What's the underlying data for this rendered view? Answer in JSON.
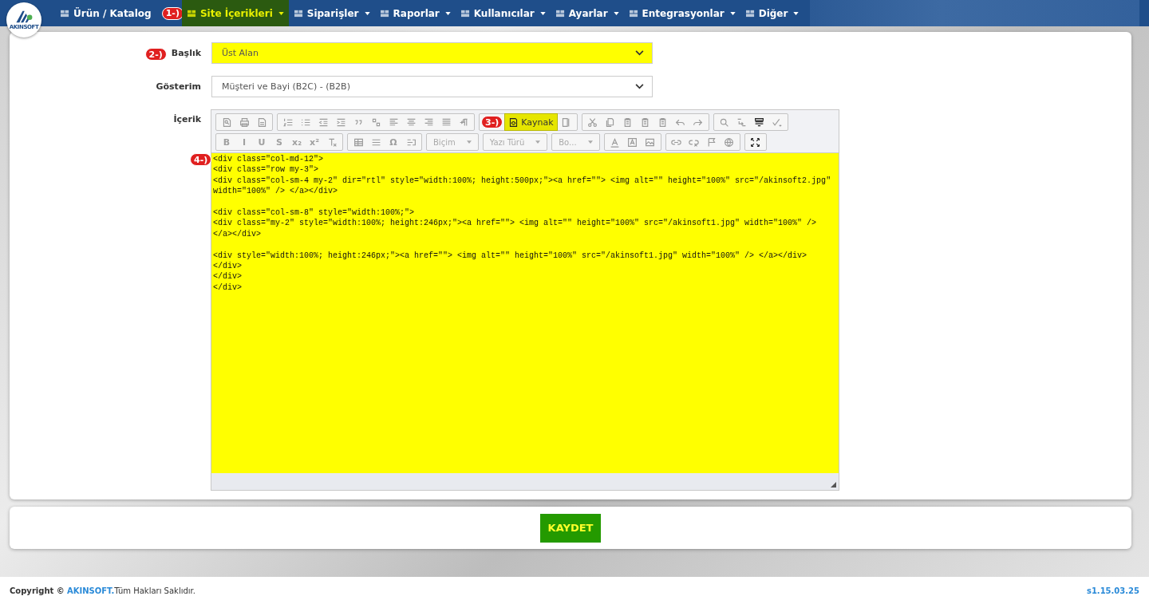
{
  "logo": {
    "text": "AKINSOFT"
  },
  "nav": [
    {
      "label": "Ürün / Katalog",
      "selected": false,
      "caret": false
    },
    {
      "label": "Site İçerikleri",
      "selected": true,
      "caret": true,
      "annotation": "1-)"
    },
    {
      "label": "Siparişler",
      "selected": false,
      "caret": true
    },
    {
      "label": "Raporlar",
      "selected": false,
      "caret": true
    },
    {
      "label": "Kullanıcılar",
      "selected": false,
      "caret": true
    },
    {
      "label": "Ayarlar",
      "selected": false,
      "caret": true
    },
    {
      "label": "Entegrasyonlar",
      "selected": false,
      "caret": true
    },
    {
      "label": "Diğer",
      "selected": false,
      "caret": true
    }
  ],
  "form": {
    "fields": [
      {
        "label": "Başlık",
        "value": "Üst Alan",
        "highlighted": true,
        "annotation": "2-)"
      },
      {
        "label": "Gösterim",
        "value": "Müşteri ve Bayi (B2C) - (B2B)",
        "highlighted": false
      }
    ],
    "editor": {
      "label": "İçerik",
      "annotation": "4-)",
      "toolbar_rows": [
        [
          [
            {
              "kind": "icon",
              "disabled": true
            },
            {
              "kind": "icon",
              "disabled": true
            },
            {
              "kind": "icon",
              "disabled": true
            }
          ],
          [
            {
              "kind": "icon",
              "disabled": true
            },
            {
              "kind": "icon",
              "disabled": true
            },
            {
              "kind": "icon",
              "disabled": true
            },
            {
              "kind": "icon",
              "disabled": true
            },
            {
              "kind": "icon",
              "disabled": true
            },
            {
              "kind": "icon",
              "disabled": true
            },
            {
              "kind": "icon",
              "disabled": true
            },
            {
              "kind": "icon",
              "disabled": true
            },
            {
              "kind": "icon",
              "disabled": true
            },
            {
              "kind": "icon",
              "disabled": true
            },
            {
              "kind": "icon",
              "disabled": true
            }
          ],
          [
            {
              "kind": "source",
              "label": "Kaynak",
              "selected": true,
              "annotation": "3-)"
            },
            {
              "kind": "icon",
              "disabled": true
            }
          ],
          [
            {
              "kind": "icon",
              "disabled": true
            },
            {
              "kind": "icon",
              "disabled": true
            },
            {
              "kind": "icon",
              "disabled": true
            },
            {
              "kind": "icon",
              "disabled": true
            },
            {
              "kind": "icon",
              "disabled": true
            },
            {
              "kind": "icon",
              "disabled": true
            },
            {
              "kind": "icon",
              "disabled": true
            }
          ],
          [
            {
              "kind": "icon",
              "disabled": true
            },
            {
              "kind": "icon",
              "disabled": true
            },
            {
              "kind": "icon",
              "disabled": false
            },
            {
              "kind": "icon",
              "disabled": true
            }
          ]
        ],
        [
          [
            {
              "kind": "glyph",
              "label": "B",
              "disabled": true
            },
            {
              "kind": "glyph",
              "label": "I",
              "disabled": true
            },
            {
              "kind": "glyph",
              "label": "U",
              "disabled": true
            },
            {
              "kind": "glyph",
              "label": "S",
              "disabled": true
            },
            {
              "kind": "glyph",
              "label": "x₂",
              "disabled": true
            },
            {
              "kind": "glyph",
              "label": "x²",
              "disabled": true
            },
            {
              "kind": "icon",
              "disabled": true
            }
          ],
          [
            {
              "kind": "icon",
              "disabled": true
            },
            {
              "kind": "icon",
              "disabled": true
            },
            {
              "kind": "glyph",
              "label": "Ω",
              "disabled": true
            },
            {
              "kind": "icon",
              "disabled": true
            }
          ],
          [
            {
              "kind": "combo",
              "label": "Biçim",
              "disabled": true
            }
          ],
          [
            {
              "kind": "combo",
              "label": "Yazı Türü",
              "disabled": true
            }
          ],
          [
            {
              "kind": "combo",
              "label": "Bo...",
              "disabled": true
            }
          ],
          [
            {
              "kind": "icon",
              "disabled": true
            },
            {
              "kind": "icon",
              "disabled": true
            },
            {
              "kind": "icon",
              "disabled": true
            }
          ],
          [
            {
              "kind": "icon",
              "disabled": true
            },
            {
              "kind": "icon",
              "disabled": true
            },
            {
              "kind": "icon",
              "disabled": true
            },
            {
              "kind": "icon",
              "disabled": true
            }
          ],
          [
            {
              "kind": "icon",
              "disabled": false
            }
          ]
        ]
      ],
      "highlighted": true,
      "code": [
        [
          "<div class=\"col-md-12\">",
          "<div class=\"row my-3\">",
          "<div class=\"col-sm-4 my-2\" dir=\"rtl\" style=\"width:100%; height:500px;\"><a href=\"\"> <img alt=\"\" height=\"100%\" src=\"/akinsoft2.jpg\" width=\"100%\" /> </a></div>"
        ],
        [
          "<div class=\"col-sm-8\" style=\"width:100%;\">",
          "<div class=\"my-2\" style=\"width:100%; height:246px;\"><a href=\"\"> <img alt=\"\" height=\"100%\" src=\"/akinsoft1.jpg\" width=\"100%\" /> </a></div>"
        ],
        [
          "<div style=\"width:100%; height:246px;\"><a href=\"\"> <img alt=\"\" height=\"100%\" src=\"/akinsoft1.jpg\" width=\"100%\" /> </a></div>",
          "</div>",
          "</div>",
          "</div>"
        ]
      ]
    }
  },
  "save_button": "KAYDET",
  "footer": {
    "copyright": "Copyright ©",
    "brand": "AKINSOFT.",
    "rights": "Tüm Hakları Saklıdır.",
    "version": "s1.15.03.25"
  }
}
